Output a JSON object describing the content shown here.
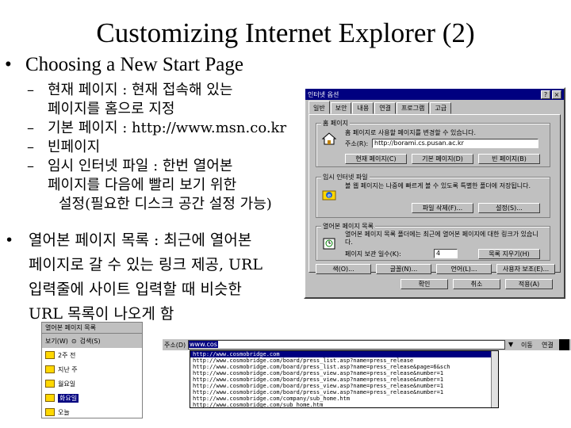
{
  "slide": {
    "title": "Customizing Internet Explorer (2)",
    "bullet_symbol": "•",
    "dash_symbol": "–",
    "main_bullet": "Choosing a New Start Page",
    "subitems": [
      {
        "lines": [
          "현재 페이지 : 현재 접속해 있는",
          "페이지를 홈으로 지정"
        ]
      },
      {
        "lines": [
          "기본 페이지 : http://www.msn.co.kr"
        ]
      },
      {
        "lines": [
          "빈페이지"
        ]
      },
      {
        "lines": [
          "임시 인터넷 파일 : 한번 열어본",
          "페이지를 다음에 빨리 보기 위한",
          "설정(필요한 디스크 공간 설정 가능)"
        ]
      }
    ],
    "second_bullet": [
      "열어본 페이지 목록 : 최근에 열어본",
      "페이지로 갈 수 있는 링크 제공, URL",
      "입력줄에 사이트 입력할 때 비슷한",
      "URL 목록이 나오게 함"
    ]
  },
  "dialog": {
    "title": "인터넷 옵션",
    "title_buttons": [
      "?",
      "×"
    ],
    "tabs": [
      "일반",
      "보안",
      "내용",
      "연결",
      "프로그램",
      "고급"
    ],
    "home_group": {
      "legend": "홈 페이지",
      "text": "홈 페이지로 사용할 페이지를 변경할 수 있습니다.",
      "address_label": "주소(R):",
      "address_value": "http://borami.cs.pusan.ac.kr",
      "buttons": [
        "현재 페이지(C)",
        "기본 페이지(D)",
        "빈 페이지(B)"
      ]
    },
    "temp_group": {
      "legend": "임시 인터넷 파일",
      "text": "볼 웹 페이지는 나중에 빠르게 볼 수 있도록 특별한 폴더에 저장됩니다.",
      "buttons": [
        "파일 삭제(F)...",
        "설정(S)..."
      ]
    },
    "history_group": {
      "legend": "열어본 페이지 목록",
      "text": "열어본 페이지 목록 폴더에는 최근에 열어본 페이지에 대한 링크가 있습니다.",
      "days_label": "페이지 보관 일수(K):",
      "days_value": "4",
      "button": "목록 지우기(H)"
    },
    "bottom_buttons": [
      "색(O)...",
      "글꼴(N)...",
      "언어(L)...",
      "사용자 보조(E)..."
    ],
    "action_buttons": [
      "확인",
      "취소",
      "적용(A)"
    ]
  },
  "history_pane": {
    "header": "열어본 페이지 목록",
    "view_label": "보기(W)",
    "search_label": "검색(S)",
    "items": [
      "2주 전",
      "지난 주",
      "월요일",
      "화요일",
      "오늘"
    ],
    "selected_index": 3
  },
  "address_bar": {
    "label": "주소(D)",
    "typed": "www.cos",
    "go_label": "이동",
    "links_label": "연결",
    "urls": [
      "http://www.cosmobridge.com",
      "http://www.cosmobridge.com/board/press_list.asp?name=press_release",
      "http://www.cosmobridge.com/board/press_list.asp?name=press_release&page=6&sch",
      "http://www.cosmobridge.com/board/press_view.asp?name=press_release&number=1",
      "http://www.cosmobridge.com/board/press_view.asp?name=press_release&number=1",
      "http://www.cosmobridge.com/board/press_view.asp?name=press_release&number=1",
      "http://www.cosmobridge.com/board/press_view.asp?name=press_release&number=1",
      "http://www.cosmobridge.com/company/sub_home.htm",
      "http://www.cosmobridge.com/sub_home.htm"
    ]
  }
}
